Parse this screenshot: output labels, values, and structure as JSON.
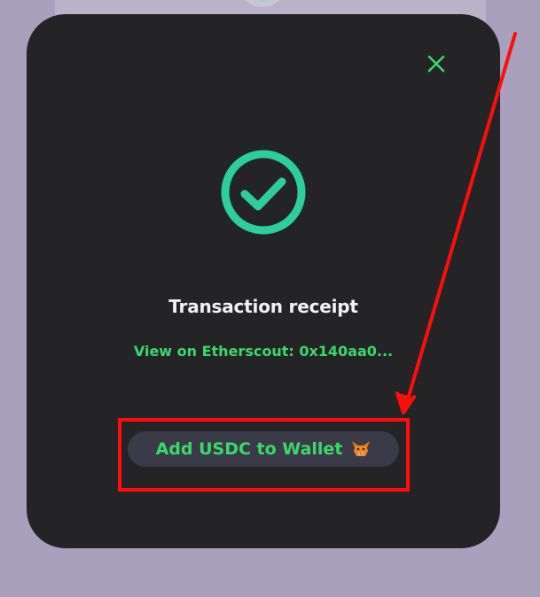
{
  "modal": {
    "title": "Transaction receipt",
    "explorer_link": "View on Etherscout: 0x140aa0...",
    "add_token_button": "Add USDC to Wallet"
  },
  "icons": {
    "close": "close-icon",
    "success": "check-circle-icon",
    "wallet": "fox-wallet-icon"
  },
  "colors": {
    "accent_green": "#3ad96a",
    "success_teal": "#2ccf9c",
    "modal_bg": "#242426",
    "annotation_red": "#ff0c0c"
  }
}
